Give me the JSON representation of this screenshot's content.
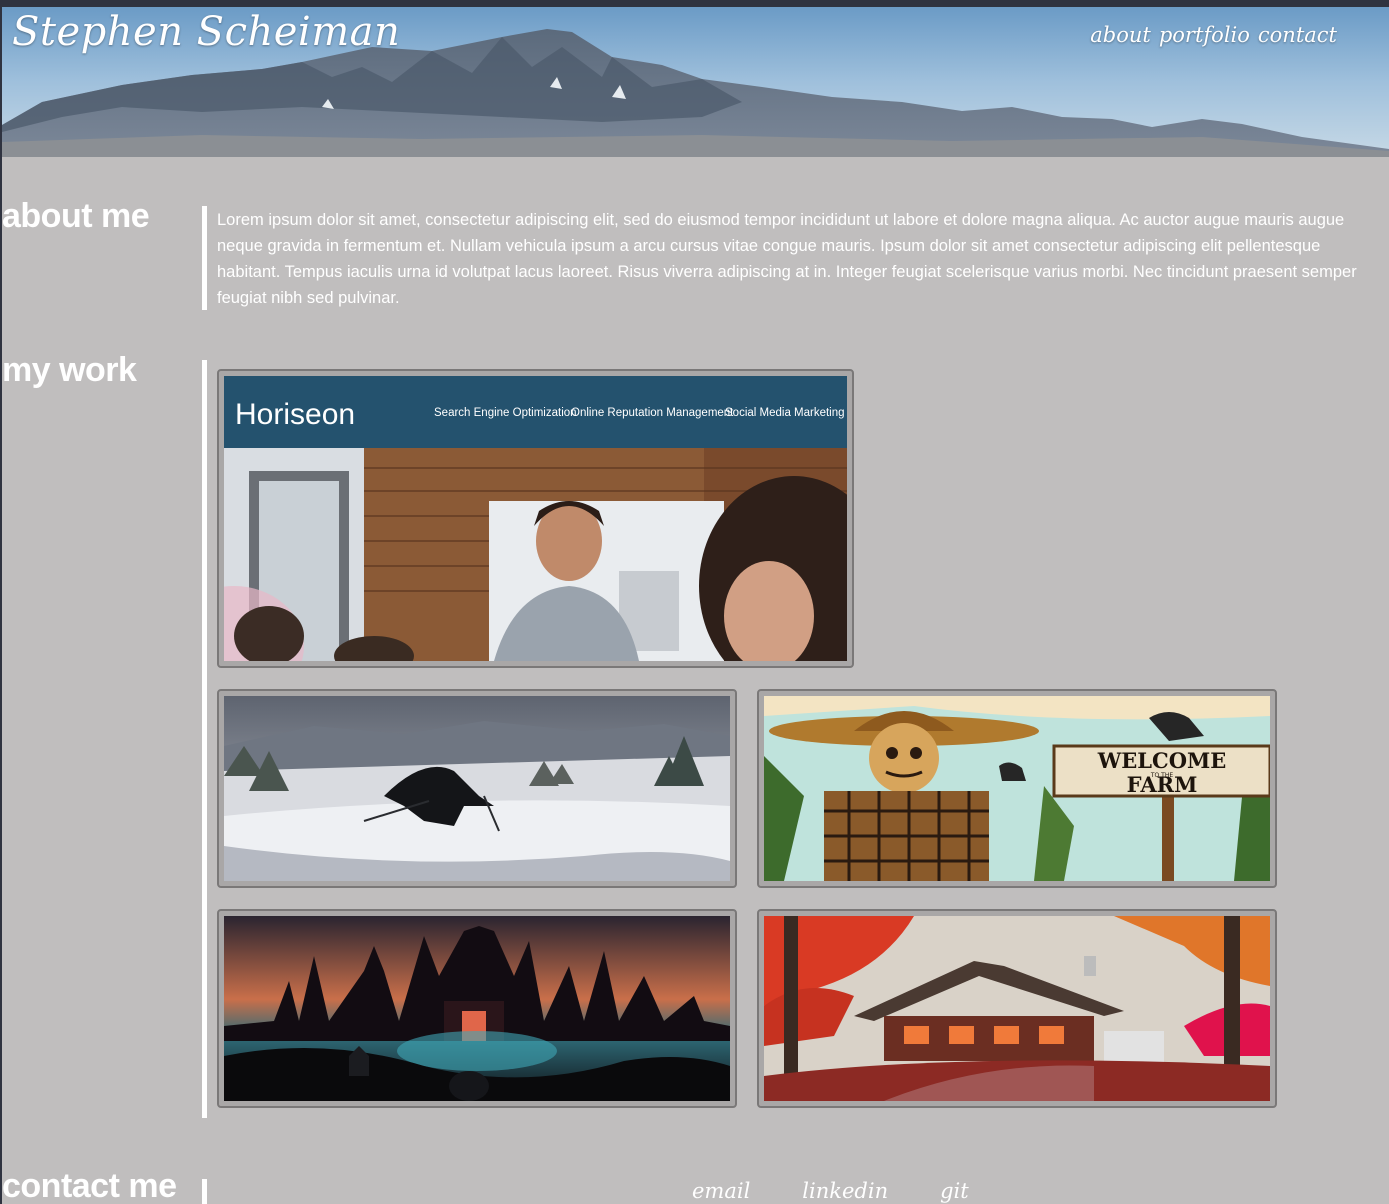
{
  "header": {
    "title": "Stephen Scheiman",
    "nav": [
      "about",
      "portfolio",
      "contact"
    ]
  },
  "about": {
    "heading": "about me",
    "text": "Lorem ipsum dolor sit amet, consectetur adipiscing elit, sed do eiusmod tempor incididunt ut labore et dolore magna aliqua. Ac auctor augue mauris augue neque gravida in fermentum et. Nullam vehicula ipsum a arcu cursus vitae congue mauris. Ipsum dolor sit amet consectetur adipiscing elit pellentesque habitant. Tempus iaculis urna id volutpat lacus laoreet. Risus viverra adipiscing at in. Integer feugiat scelerisque varius morbi. Nec tincidunt praesent semper feugiat nibh sed pulvinar."
  },
  "work": {
    "heading": "my work",
    "featured": {
      "brand": "Horiseon",
      "menu": [
        "Search Engine Optimization",
        "Online Reputation Management",
        "Social Media Marketing"
      ]
    },
    "thumbnails": [
      {
        "subject": "skier"
      },
      {
        "subject": "scarecrow",
        "sign_line1": "WELCOME",
        "sign_small": "TO THE",
        "sign_line2": "FARM"
      },
      {
        "subject": "haunted-castle"
      },
      {
        "subject": "autumn-cabin"
      }
    ]
  },
  "contact": {
    "heading": "contact me",
    "links": [
      "email",
      "linkedin",
      "git"
    ]
  },
  "colors": {
    "page_bg": "#c0bebe",
    "horiseon_nav": "#24526e",
    "text": "#ffffff"
  }
}
